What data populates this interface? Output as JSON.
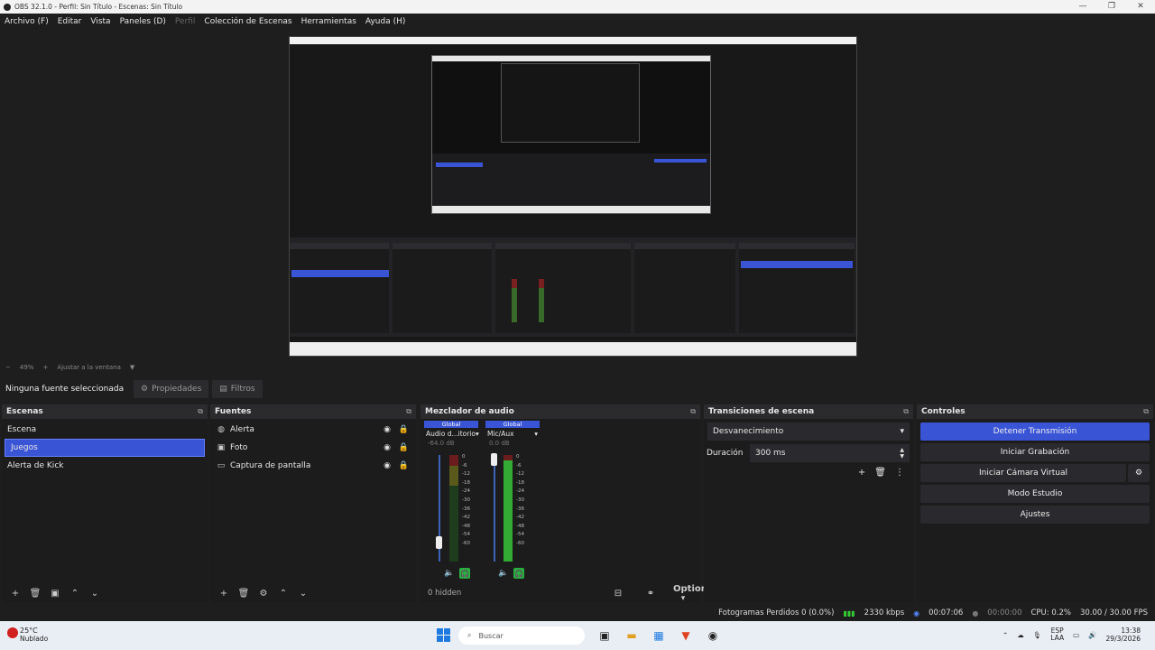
{
  "window": {
    "title": "OBS 32.1.0 - Perfil: Sin Título - Escenas: Sin Título",
    "controls": [
      "—",
      "❐",
      "✕"
    ]
  },
  "menu": [
    "Archivo (F)",
    "Editar",
    "Vista",
    "Paneles (D)",
    "Perfil",
    "Colección de Escenas",
    "Herramientas",
    "Ayuda (H)"
  ],
  "zoom": {
    "level": "49%",
    "fit_label": "Ajustar a la ventana"
  },
  "source_bar": {
    "no_source": "Ninguna fuente seleccionada",
    "properties": "Propiedades",
    "filters": "Filtros"
  },
  "scenes": {
    "title": "Escenas",
    "items": [
      "Escena",
      "Juegos",
      "Alerta de Kick"
    ],
    "selected_index": 1
  },
  "sources": {
    "title": "Fuentes",
    "items": [
      {
        "name": "Alerta",
        "icon": "globe-icon"
      },
      {
        "name": "Foto",
        "icon": "image-icon"
      },
      {
        "name": "Captura de pantalla",
        "icon": "monitor-icon"
      }
    ]
  },
  "mixer": {
    "title": "Mezclador de audio",
    "channels": [
      {
        "badge": "Global",
        "name": "Audio d...itorio",
        "db": "-64.0 dB",
        "level": 0.0
      },
      {
        "badge": "Global",
        "name": "Mic/Aux",
        "db": "0.0 dB",
        "level": 0.95
      }
    ],
    "scale": [
      "0",
      "-6",
      "-12",
      "-18",
      "-24",
      "-30",
      "-36",
      "-42",
      "-48",
      "-54",
      "-60"
    ],
    "hidden": "0 hidden",
    "options": "Options"
  },
  "transitions": {
    "title": "Transiciones de escena",
    "selected": "Desvanecimiento",
    "duration_label": "Duración",
    "duration_value": "300 ms"
  },
  "controls": {
    "title": "Controles",
    "buttons": [
      "Detener Transmisión",
      "Iniciar Grabación",
      "Iniciar Cámara Virtual",
      "Modo Estudio",
      "Ajustes"
    ]
  },
  "status": {
    "dropped": "Fotogramas Perdidos 0 (0.0%)",
    "bitrate": "2330 kbps",
    "stream_time": "00:07:06",
    "rec_time": "00:00:00",
    "cpu": "CPU: 0.2%",
    "fps": "30.00 / 30.00 FPS"
  },
  "taskbar": {
    "weather_temp": "25°C",
    "weather_cond": "Nublado",
    "search": "Buscar",
    "lang1": "ESP",
    "lang2": "LAA",
    "time": "13:38",
    "date": "29/3/2026"
  },
  "colors": {
    "accent": "#3a54d6",
    "background": "#1f1e1f",
    "panel": "#2b2b2e",
    "meter_green": "#33aa33"
  }
}
